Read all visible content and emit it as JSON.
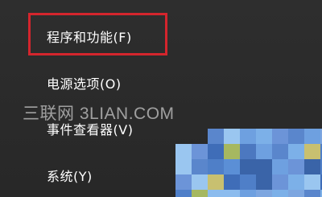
{
  "context_menu": {
    "items": [
      {
        "label": "程序和功能(F)"
      },
      {
        "label": "电源选项(O)"
      },
      {
        "label": "事件查看器(V)"
      },
      {
        "label": "系统(Y)"
      }
    ]
  },
  "watermark": {
    "text": "三联网 3LIAN.COM"
  },
  "colors": {
    "menu_background": "#2b2b2b",
    "menu_text": "#ffffff",
    "highlight_border": "#d4252d"
  }
}
